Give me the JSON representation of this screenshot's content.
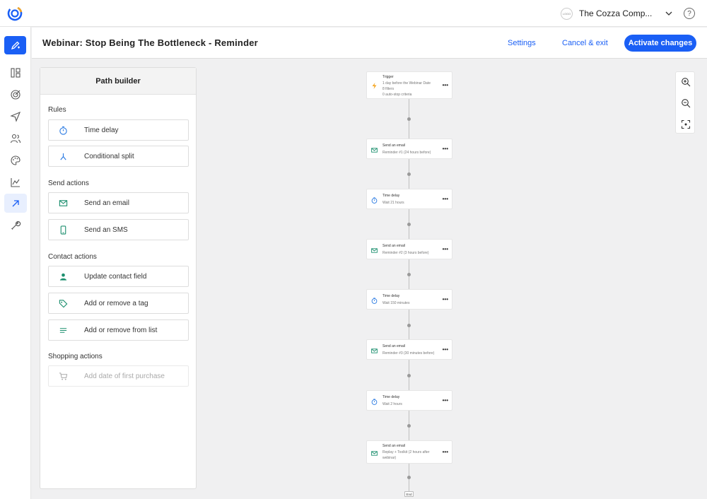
{
  "app": {
    "account_name": "The Cozza Comp...",
    "account_logo_text": "LOGO",
    "help_label": "?"
  },
  "rail": {
    "items": [
      {
        "icon": "compose-icon",
        "active": false
      },
      {
        "icon": "dashboard-icon",
        "active": false
      },
      {
        "icon": "target-icon",
        "active": false
      },
      {
        "icon": "send-icon",
        "active": false
      },
      {
        "icon": "contacts-icon",
        "active": false
      },
      {
        "icon": "palette-icon",
        "active": false
      },
      {
        "icon": "reports-icon",
        "active": false
      },
      {
        "icon": "automation-icon",
        "active": true
      },
      {
        "icon": "tools-icon",
        "active": false
      }
    ]
  },
  "header": {
    "title": "Webinar: Stop Being The Bottleneck - Reminder",
    "settings_label": "Settings",
    "cancel_label": "Cancel & exit",
    "activate_label": "Activate changes"
  },
  "path_builder": {
    "title": "Path builder",
    "sections": {
      "rules": "Rules",
      "send": "Send actions",
      "contact": "Contact actions",
      "shopping": "Shopping actions"
    },
    "items": {
      "time_delay": "Time delay",
      "conditional_split": "Conditional split",
      "send_email": "Send an email",
      "send_sms": "Send an SMS",
      "update_contact": "Update contact field",
      "add_remove_tag": "Add or remove a tag",
      "add_remove_list": "Add or remove from list",
      "first_purchase": "Add date of first purchase"
    }
  },
  "flow": {
    "trigger": {
      "title": "Trigger",
      "line1": "1 day before the Webinar Date",
      "line2": "8 filters",
      "line3": "0 auto-stop criteria"
    },
    "nodes": [
      {
        "type": "email",
        "title": "Send an email",
        "sub": "Reminder #1 (24 hours before)"
      },
      {
        "type": "delay",
        "title": "Time delay",
        "sub": "Wait 21 hours"
      },
      {
        "type": "email",
        "title": "Send an email",
        "sub": "Reminder #2 (3 hours before)"
      },
      {
        "type": "delay",
        "title": "Time delay",
        "sub": "Wait 150 minutes"
      },
      {
        "type": "email",
        "title": "Send an email",
        "sub": "Reminder #3 (30 minutes before)"
      },
      {
        "type": "delay",
        "title": "Time delay",
        "sub": "Wait 2 hours"
      },
      {
        "type": "email",
        "title": "Send an email",
        "sub": "Replay + Toolkit (2 hours after webinar)"
      }
    ],
    "more_label": "•••",
    "end_label": "End"
  },
  "colors": {
    "accent": "#1a5ff5",
    "email_icon": "#1c8f6e",
    "delay_icon": "#2a7ae2",
    "trigger_icon": "#f5a623"
  }
}
